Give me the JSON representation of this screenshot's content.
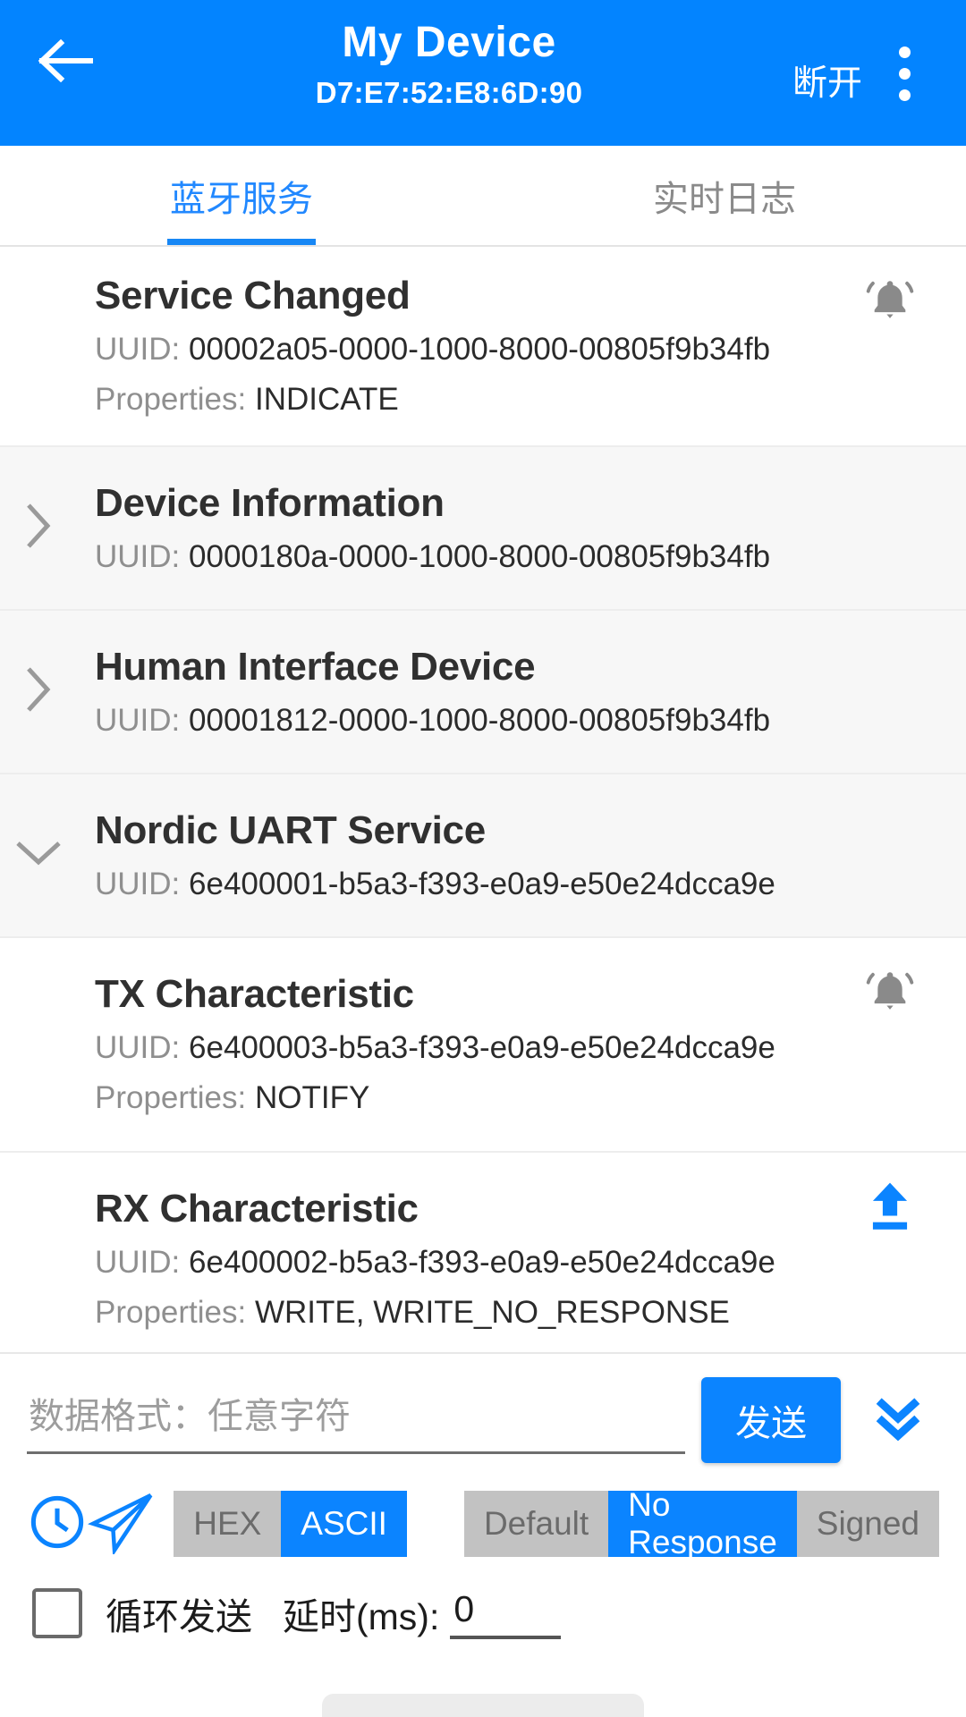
{
  "appbar": {
    "back_icon": "arrow-left-icon",
    "title": "My Device",
    "subtitle": "D7:E7:52:E8:6D:90",
    "disconnect_label": "断开",
    "menu_icon": "overflow-menu-icon",
    "background_color": "#0384FF"
  },
  "tabs": [
    {
      "label": "蓝牙服务",
      "active": true
    },
    {
      "label": "实时日志",
      "active": false
    }
  ],
  "labels": {
    "uuid_prefix": "UUID:",
    "properties_prefix": "Properties:"
  },
  "items": [
    {
      "kind": "characteristic",
      "name": "Service Changed",
      "uuid": "00002a05-0000-1000-8000-00805f9b34fb",
      "properties": "INDICATE",
      "action_icon": "notification-bell-active-icon",
      "action_color": "#8a8a8a",
      "chevron": null
    },
    {
      "kind": "service",
      "name": "Device Information",
      "uuid": "0000180a-0000-1000-8000-00805f9b34fb",
      "properties": null,
      "action_icon": null,
      "chevron": "chevron-right-icon"
    },
    {
      "kind": "service",
      "name": "Human Interface Device",
      "uuid": "00001812-0000-1000-8000-00805f9b34fb",
      "properties": null,
      "action_icon": null,
      "chevron": "chevron-right-icon"
    },
    {
      "kind": "service",
      "name": "Nordic UART Service",
      "uuid": "6e400001-b5a3-f393-e0a9-e50e24dcca9e",
      "properties": null,
      "action_icon": null,
      "chevron": "chevron-down-icon"
    },
    {
      "kind": "characteristic",
      "name": "TX Characteristic",
      "uuid": "6e400003-b5a3-f393-e0a9-e50e24dcca9e",
      "properties": "NOTIFY",
      "action_icon": "notification-bell-active-icon",
      "action_color": "#8a8a8a",
      "chevron": null
    },
    {
      "kind": "characteristic",
      "name": "RX Characteristic",
      "uuid": "6e400002-b5a3-f393-e0a9-e50e24dcca9e",
      "properties": "WRITE, WRITE_NO_RESPONSE",
      "action_icon": "upload-icon",
      "action_color": "#0b84ff",
      "chevron": null
    }
  ],
  "sendbar": {
    "input_value": "",
    "input_placeholder": "数据格式：任意字符",
    "send_label": "发送",
    "expand_icon": "double-chevron-down-icon"
  },
  "toolbar": {
    "history_icon": "clock-icon",
    "quick_send_icon": "paper-plane-icon",
    "format_options": [
      {
        "label": "HEX",
        "active": false
      },
      {
        "label": "ASCII",
        "active": true
      }
    ],
    "write_modes": [
      {
        "label": "Default",
        "active": false
      },
      {
        "label": "No Response",
        "active": true
      },
      {
        "label": "Signed",
        "active": false
      }
    ]
  },
  "loop": {
    "checked": false,
    "label": "循环发送",
    "delay_label": "延时(ms):",
    "delay_value": "0"
  },
  "colors": {
    "primary": "#0384FF",
    "accent": "#0b84ff",
    "service_row_bg": "#f7f7f7",
    "muted_text": "#8f8f8f"
  }
}
